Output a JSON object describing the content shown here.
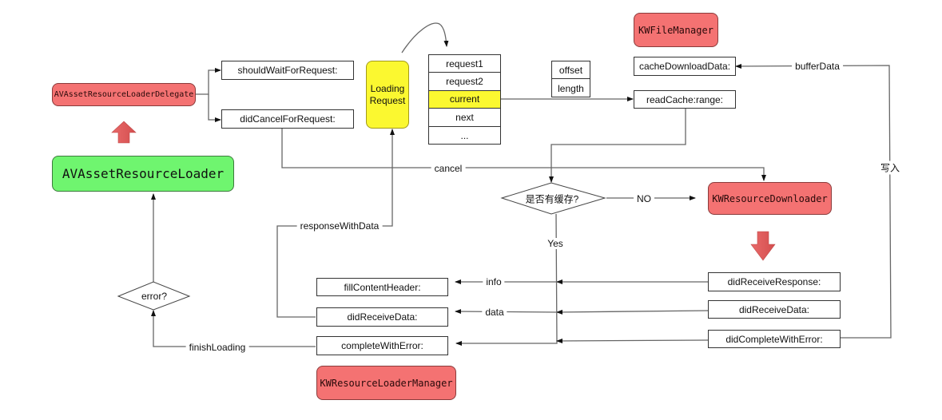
{
  "diagram": {
    "nodes": {
      "delegate": "AVAssetResourceLoaderDelegate",
      "loader": "AVAssetResourceLoader",
      "should_wait": "shouldWaitForRequest:",
      "did_cancel": "didCancelForRequest:",
      "loading_request": "Loading Request",
      "file_manager": "KWFileManager",
      "cache_download": "cacheDownloadData:",
      "read_cache": "readCache:range:",
      "downloader": "KWResourceDownloader",
      "has_cache": "是否有缓存?",
      "error_check": "error?",
      "fill_content_header": "fillContentHeader:",
      "did_receive_data_mgr": "didReceiveData:",
      "complete_with_error": "completeWithError:",
      "loader_manager": "KWResourceLoaderManager",
      "did_receive_response": "didReceiveResponse:",
      "did_receive_data_dl": "didReceiveData:",
      "did_complete_with_error": "didCompleteWithError:"
    },
    "request_queue": [
      "request1",
      "request2",
      "current",
      "next",
      "..."
    ],
    "range_fields": [
      "offset",
      "length"
    ],
    "edge_labels": {
      "cancel": "cancel",
      "no": "NO",
      "yes": "Yes",
      "response_with_data": "responseWithData",
      "buffer_data": "bufferData",
      "write": "写入",
      "info": "info",
      "data": "data",
      "finish_loading": "finishLoading"
    },
    "colors": {
      "red_node": "#f47272",
      "green_node": "#6ff56f",
      "yellow_node": "#fbf830",
      "line": "#555555"
    }
  }
}
